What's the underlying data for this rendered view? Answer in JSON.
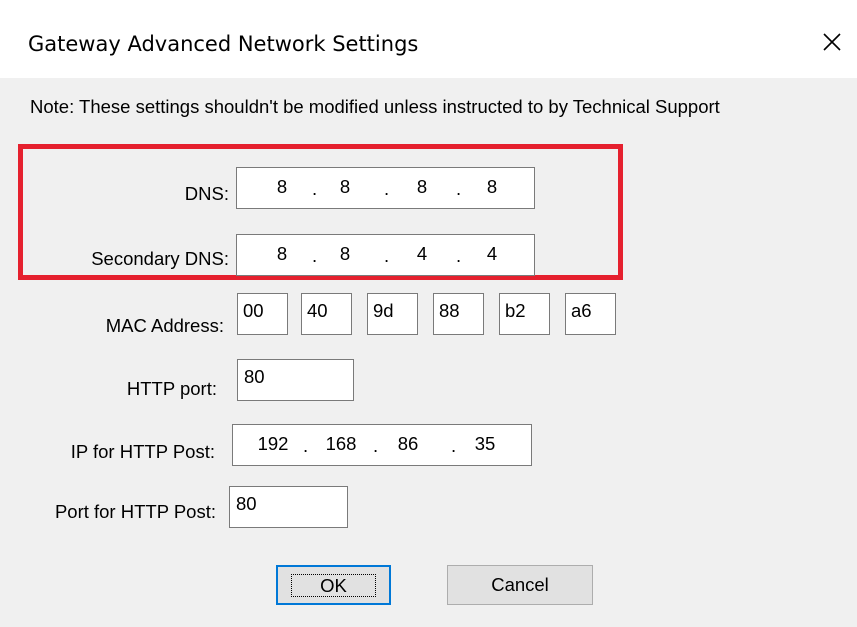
{
  "dialog": {
    "title": "Gateway Advanced Network Settings",
    "note": "Note: These settings shouldn't be modified unless instructed to by Technical Support"
  },
  "fields": {
    "dns": {
      "label": "DNS:",
      "octets": [
        "8",
        "8",
        "8",
        "8"
      ]
    },
    "secondary_dns": {
      "label": "Secondary DNS:",
      "octets": [
        "8",
        "8",
        "4",
        "4"
      ]
    },
    "mac": {
      "label": "MAC Address:",
      "parts": [
        "00",
        "40",
        "9d",
        "88",
        "b2",
        "a6"
      ]
    },
    "http_port": {
      "label": "HTTP port:",
      "value": "80"
    },
    "ip_http_post": {
      "label": "IP for HTTP Post:",
      "octets": [
        "192",
        "168",
        "86",
        "35"
      ]
    },
    "port_http_post": {
      "label": "Port for HTTP Post:",
      "value": "80"
    }
  },
  "buttons": {
    "ok": "OK",
    "cancel": "Cancel"
  },
  "ip_separator": ".",
  "colors": {
    "highlight": "#e5202e",
    "window_bg": "#f0f0f0",
    "focus_border": "#0078d7"
  }
}
